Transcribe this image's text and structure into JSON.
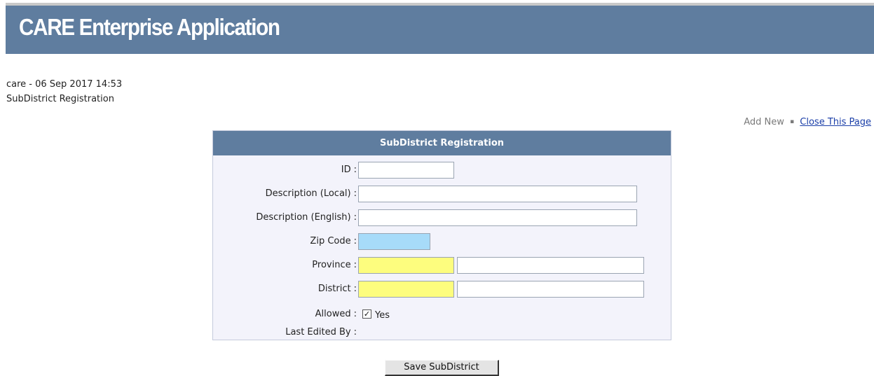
{
  "app": {
    "title": "CARE Enterprise Application"
  },
  "session": {
    "line1": "care - 06 Sep 2017 14:53",
    "line2": "SubDistrict Registration"
  },
  "toplinks": {
    "add_new": "Add New",
    "separator": "▪",
    "close": "Close This Page"
  },
  "form": {
    "header": "SubDistrict Registration",
    "fields": {
      "id": {
        "label": "ID",
        "value": ""
      },
      "desc_local": {
        "label": "Description (Local)",
        "value": ""
      },
      "desc_english": {
        "label": "Description (English)",
        "value": ""
      },
      "zip": {
        "label": "Zip Code",
        "value": ""
      },
      "province": {
        "label": "Province",
        "code": "",
        "name": ""
      },
      "district": {
        "label": "District",
        "code": "",
        "name": ""
      },
      "allowed": {
        "label": "Allowed",
        "checked": true,
        "option": "Yes",
        "check_glyph": "✓"
      },
      "last_edited": {
        "label": "Last Edited By",
        "value": ""
      }
    },
    "colon": ":",
    "save_label": "Save SubDistrict"
  },
  "colors": {
    "banner": "#5f7d9f",
    "zip_field": "#a7dbf9",
    "lookup_field": "#fdfd7e",
    "panel_bg": "#f3f3fb"
  }
}
